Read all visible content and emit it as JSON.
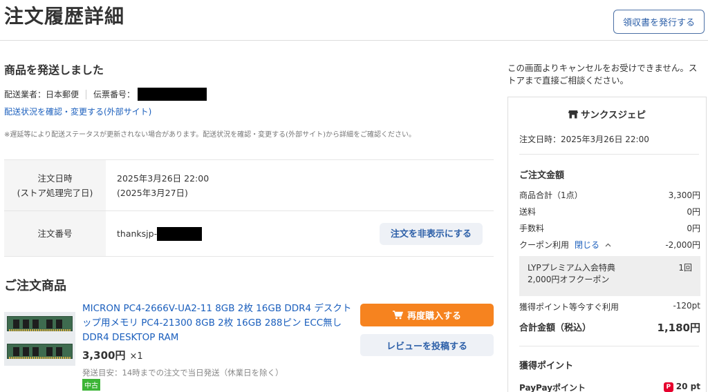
{
  "page": {
    "title": "注文履歴詳細",
    "receipt_button": "領収書を発行する"
  },
  "shipment": {
    "status": "商品を発送しました",
    "carrier_label": "配送業者：日本郵便",
    "tracking_label": "伝票番号：",
    "track_link": "配送状況を確認・変更する(外部サイト)",
    "note": "※遅延等により配送ステータスが更新されない場合があります。配送状況を確認・変更する(外部サイト)から詳細をご確認ください。"
  },
  "order_info": {
    "date_label_line1": "注文日時",
    "date_label_line2": "(ストア処理完了日)",
    "date_value": "2025年3月26日 22:00",
    "processed_value": "(2025年3月27日)",
    "number_label": "注文番号",
    "number_prefix": "thanksjp-",
    "hide_button": "注文を非表示にする"
  },
  "items": {
    "section_title": "ご注文商品",
    "list": [
      {
        "name": "MICRON PC4-2666V-UA2-11 8GB 2枚 16GB DDR4 デスクトップ用メモリ PC4-21300 8GB 2枚 16GB 288ピン ECC無し DDR4 DESKTOP RAM",
        "price": "3,300円",
        "qty": "×1",
        "shipping_note": "発送目安：14時までの注文で当日発送（休業日を除く）",
        "condition_badge": "中古",
        "rebuy_button": "再度購入する",
        "review_button": "レビューを投稿する"
      }
    ]
  },
  "sidebar": {
    "cancel_note": "この画面よりキャンセルをお受けできません。ストアまで直接ご相談ください。",
    "store_name": "サンクスジェピ",
    "order_date": "注文日時：2025年3月26日 22:00",
    "amount_heading": "ご注文金額",
    "subtotal_label": "商品合計（1点）",
    "subtotal_value": "3,300円",
    "shipping_label": "送料",
    "shipping_value": "0円",
    "fee_label": "手数料",
    "fee_value": "0円",
    "coupon_label": "クーポン利用",
    "coupon_toggle": "閉じる",
    "coupon_value": "-2,000円",
    "coupon_detail_name": "LYPプレミアム入会特典　2,000円オフクーポン",
    "coupon_detail_count": "1回",
    "points_use_label": "獲得ポイント等今すぐ利用",
    "points_use_value": "-120pt",
    "total_label": "合計金額（税込）",
    "total_value": "1,180円",
    "earned_heading": "獲得ポイント",
    "paypay_label": "PayPayポイント",
    "paypay_value": "20 pt"
  },
  "colors": {
    "link": "#1b5fbd",
    "primary_button": "#f6831f",
    "secondary_button_bg": "#eef1f6",
    "used_badge": "#3cb536",
    "paypay_red": "#e6002d"
  },
  "icons": {
    "cart": "cart-icon",
    "store": "store-icon",
    "chevron_up": "chevron-up-icon",
    "paypay": "paypay-icon"
  }
}
